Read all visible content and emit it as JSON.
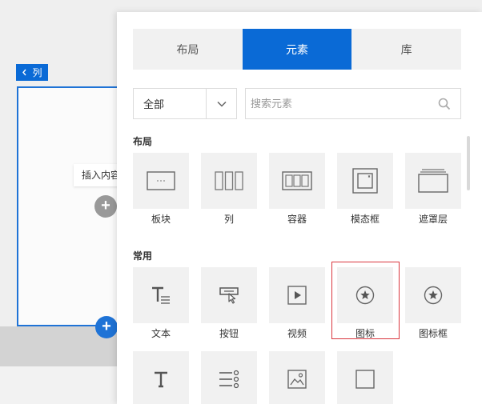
{
  "canvas": {
    "column_tag": "列",
    "insert_tooltip": "插入内容",
    "plus": "+"
  },
  "panel": {
    "tabs": [
      {
        "label": "布局",
        "active": false
      },
      {
        "label": "元素",
        "active": true
      },
      {
        "label": "库",
        "active": false
      }
    ],
    "filter": {
      "value": "全部"
    },
    "search": {
      "placeholder": "搜索元素",
      "value": ""
    },
    "sections": {
      "layout": {
        "title": "布局",
        "items": [
          {
            "label": "板块",
            "icon": "block-icon"
          },
          {
            "label": "列",
            "icon": "columns-icon"
          },
          {
            "label": "容器",
            "icon": "container-icon"
          },
          {
            "label": "模态框",
            "icon": "modal-icon"
          },
          {
            "label": "遮罩层",
            "icon": "overlay-icon"
          }
        ]
      },
      "common": {
        "title": "常用",
        "items": [
          {
            "label": "文本",
            "icon": "text-icon"
          },
          {
            "label": "按钮",
            "icon": "button-icon"
          },
          {
            "label": "视频",
            "icon": "video-icon"
          },
          {
            "label": "图标",
            "icon": "star-circle-icon",
            "selected": true
          },
          {
            "label": "图标框",
            "icon": "icon-box-icon"
          },
          {
            "label": "",
            "icon": "heading-icon"
          },
          {
            "label": "",
            "icon": "list-icon"
          },
          {
            "label": "",
            "icon": "image-icon"
          },
          {
            "label": "",
            "icon": "square-icon"
          }
        ]
      }
    }
  },
  "colors": {
    "accent": "#0a6ad6",
    "selection": "#d9363e"
  }
}
